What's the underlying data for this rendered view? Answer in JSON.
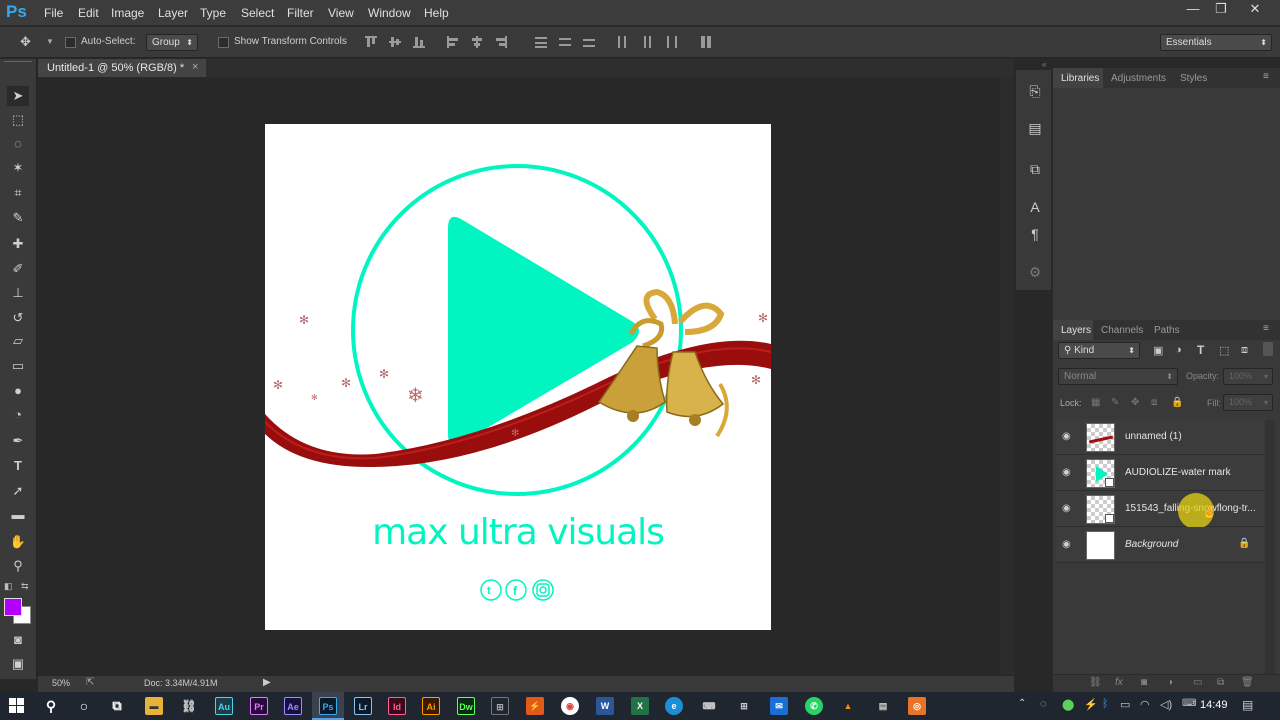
{
  "app": {
    "logo": "Ps",
    "window_controls": [
      "—",
      "❐",
      "✕"
    ]
  },
  "menu": [
    "File",
    "Edit",
    "Image",
    "Layer",
    "Type",
    "Select",
    "Filter",
    "View",
    "Window",
    "Help"
  ],
  "options": {
    "auto_select_label": "Auto-Select:",
    "auto_select_value": "Group",
    "show_transform_label": "Show Transform Controls",
    "workspace": "Essentials"
  },
  "document": {
    "tab_title": "Untitled-1 @ 50% (RGB/8) *",
    "tab_close": "×"
  },
  "status": {
    "zoom": "50%",
    "doc_size": "Doc: 3.34M/4.91M"
  },
  "artwork": {
    "brand_text": "max ultra visuals",
    "accent": "#00f5c0",
    "ribbon": "#a50f0f"
  },
  "panels": {
    "top_tabs": [
      "Libraries",
      "Adjustments",
      "Styles"
    ],
    "layer_tabs": [
      "Layers",
      "Channels",
      "Paths"
    ],
    "filter_kind": "Kind",
    "blend_mode": "Normal",
    "opacity_label": "Opacity:",
    "opacity_value": "100%",
    "lock_label": "Lock:",
    "fill_label": "Fill:",
    "fill_value": "100%"
  },
  "layers": [
    {
      "name": "unnamed (1)"
    },
    {
      "name": "AUDIOLIZE-water mark"
    },
    {
      "name": "151543_falling-snowflong-tr..."
    },
    {
      "name": "Background"
    }
  ],
  "taskbar": {
    "time": "14:49"
  },
  "colors": {
    "foreground": "#b000ff",
    "background": "#ffffff"
  }
}
